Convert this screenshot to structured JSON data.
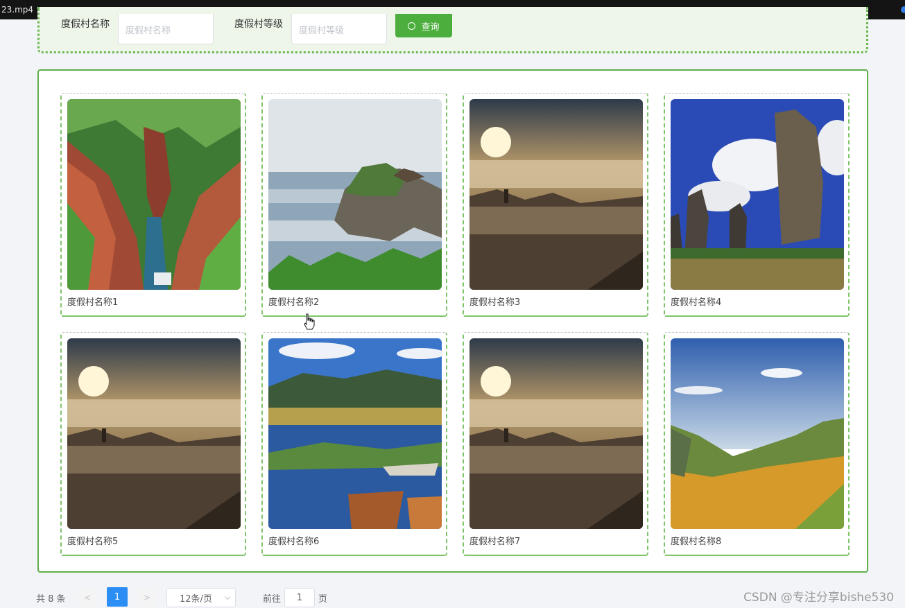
{
  "window": {
    "title": "23.mp4"
  },
  "search": {
    "name_label": "度假村名称",
    "name_placeholder": "度假村名称",
    "level_label": "度假村等级",
    "level_placeholder": "度假村等级",
    "query_label": "查询"
  },
  "resorts": [
    {
      "name": "度假村名称1",
      "scene": "canyon"
    },
    {
      "name": "度假村名称2",
      "scene": "sea-rock"
    },
    {
      "name": "度假村名称3",
      "scene": "sunrise-clouds"
    },
    {
      "name": "度假村名称4",
      "scene": "stone-forest"
    },
    {
      "name": "度假村名称5",
      "scene": "sunrise-clouds"
    },
    {
      "name": "度假村名称6",
      "scene": "lake-boats"
    },
    {
      "name": "度假村名称7",
      "scene": "sunrise-clouds"
    },
    {
      "name": "度假村名称8",
      "scene": "grassland"
    }
  ],
  "pagination": {
    "total": "共 8 条",
    "prev": "<",
    "current_page": "1",
    "next": ">",
    "page_size": "12条/页",
    "goto_label": "前往",
    "goto_value": "1",
    "page_unit": "页"
  },
  "watermark": "CSDN @专注分享bishe530",
  "colors": {
    "accent": "#4cae3c",
    "border": "#5fb049",
    "pager_active": "#2b8ef5"
  }
}
